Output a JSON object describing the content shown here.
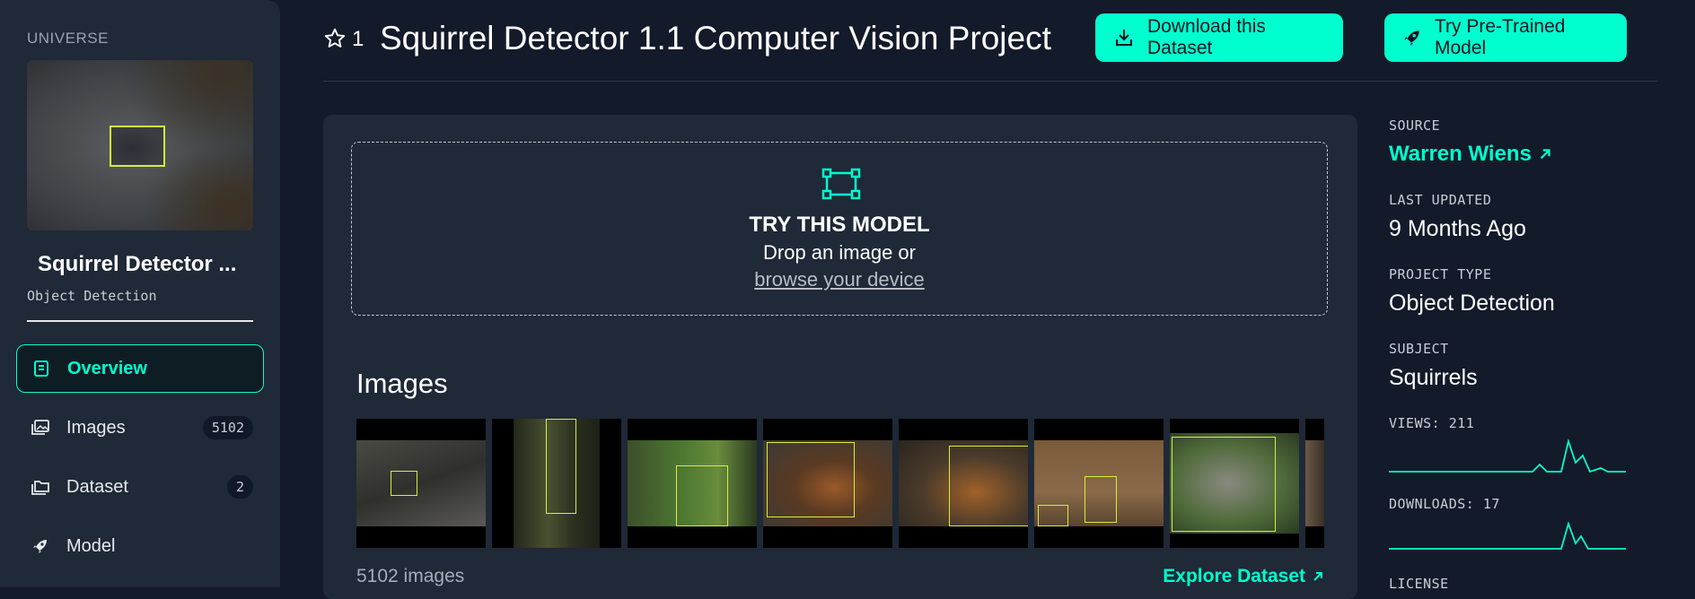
{
  "sidebar": {
    "section_label": "UNIVERSE",
    "project_name": "Squirrel Detector ...",
    "project_type": "Object Detection",
    "nav": [
      {
        "label": "Overview",
        "active": true,
        "icon": "book-icon"
      },
      {
        "label": "Images",
        "badge": "5102",
        "icon": "images-icon"
      },
      {
        "label": "Dataset",
        "badge": "2",
        "icon": "folders-icon"
      },
      {
        "label": "Model",
        "icon": "rocket-icon"
      }
    ]
  },
  "header": {
    "star_count": "1",
    "title": "Squirrel Detector 1.1 Computer Vision Project",
    "download_label": "Download this Dataset",
    "try_model_label": "Try Pre-Trained Model"
  },
  "dropzone": {
    "title": "TRY THIS MODEL",
    "text": "Drop an image or",
    "link": "browse your device"
  },
  "images": {
    "heading": "Images",
    "count_text": "5102 images",
    "explore_label": "Explore Dataset"
  },
  "meta": {
    "source_label": "SOURCE",
    "source_value": "Warren Wiens",
    "updated_label": "LAST UPDATED",
    "updated_value": "9 Months Ago",
    "type_label": "PROJECT TYPE",
    "type_value": "Object Detection",
    "subject_label": "SUBJECT",
    "subject_value": "Squirrels",
    "views_label": "VIEWS: 211",
    "downloads_label": "DOWNLOADS: 17",
    "license_label": "LICENSE"
  },
  "colors": {
    "accent": "#00ffce",
    "background": "#131a2a",
    "panel": "#1f2937",
    "bbox": "#d4ef3c"
  }
}
